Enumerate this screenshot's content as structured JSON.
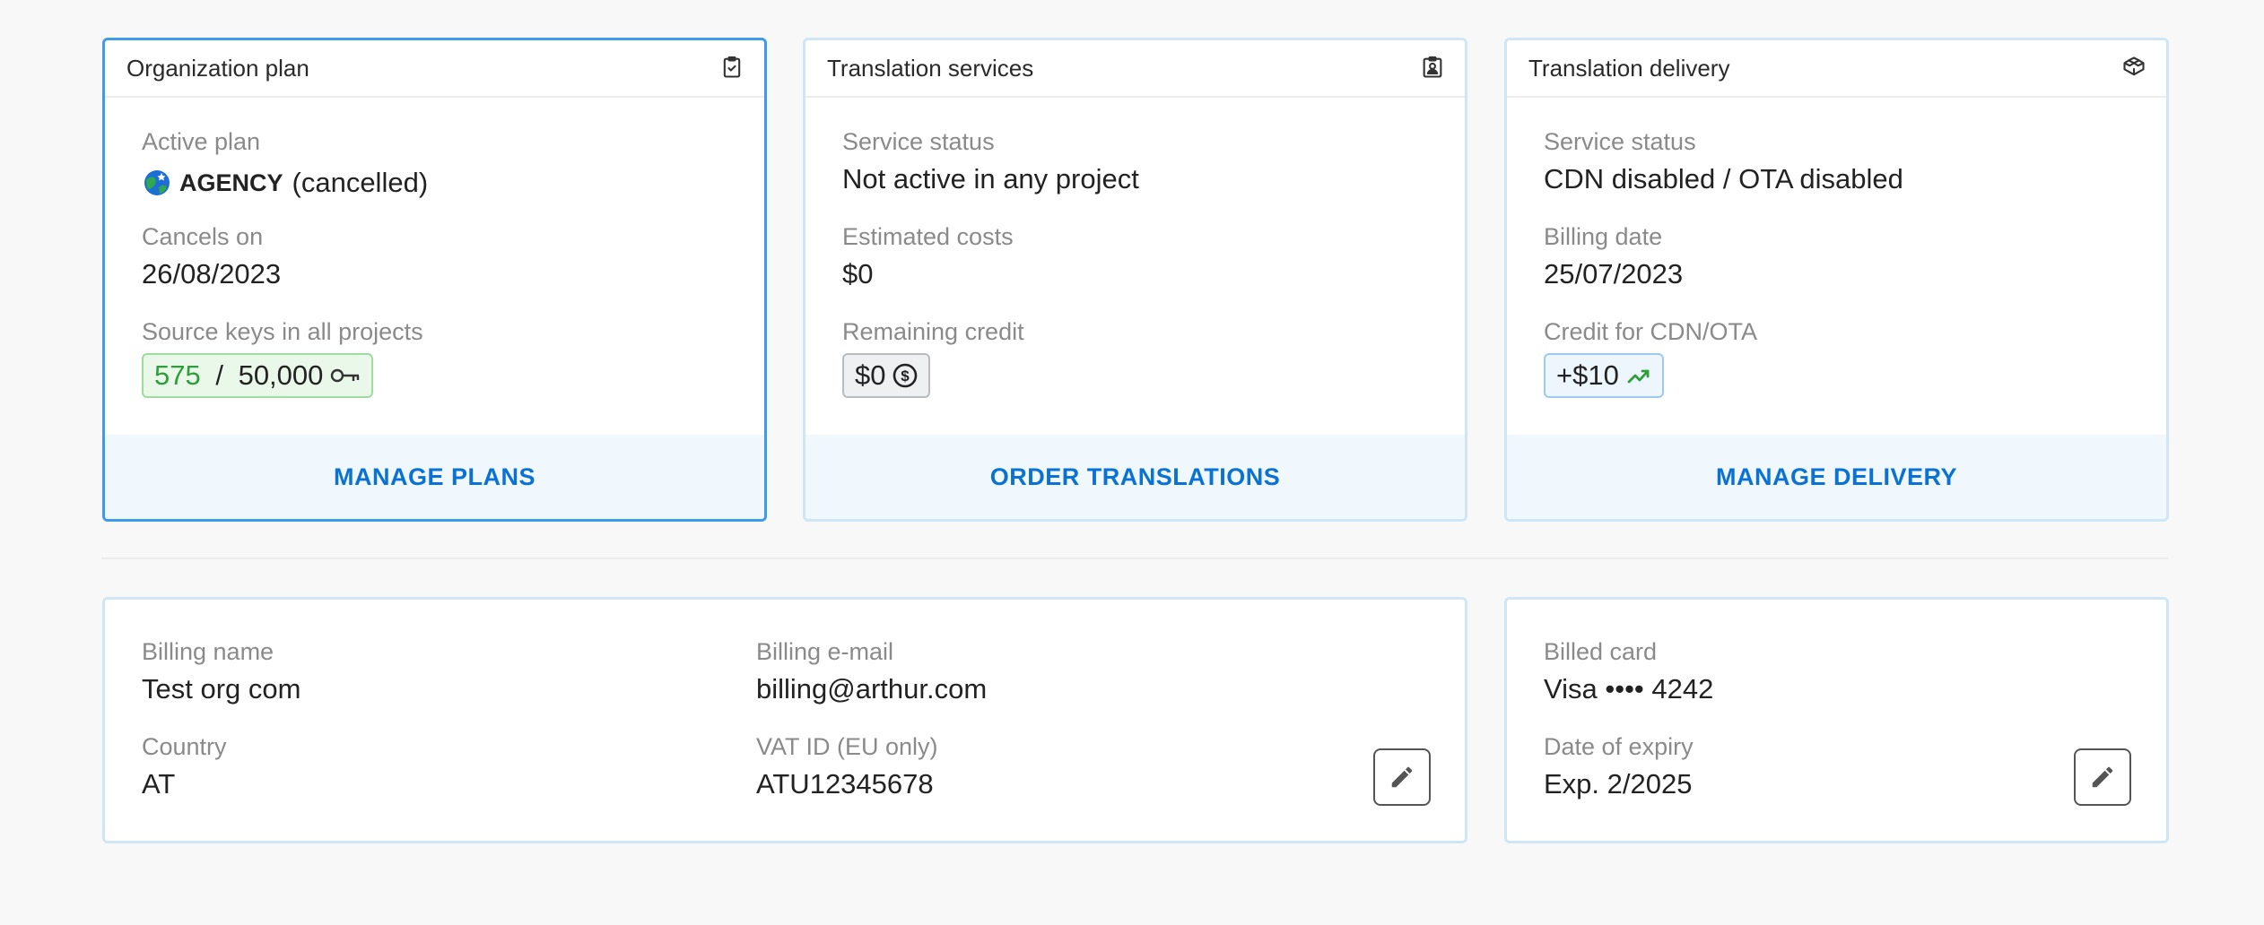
{
  "org_plan": {
    "title": "Organization plan",
    "icon": "clipboard-check-icon",
    "active_plan_label": "Active plan",
    "plan_name": "AGENCY",
    "plan_status": "(cancelled)",
    "cancels_on_label": "Cancels on",
    "cancels_on_value": "26/08/2023",
    "source_keys_label": "Source keys in all projects",
    "keys_used": "575",
    "keys_separator": " / ",
    "keys_limit": "50,000",
    "footer_link": "MANAGE PLANS"
  },
  "translation_services": {
    "title": "Translation services",
    "icon": "badge-icon",
    "status_label": "Service status",
    "status_value": "Not active in any project",
    "costs_label": "Estimated costs",
    "costs_value": "$0",
    "credit_label": "Remaining credit",
    "credit_value": "$0",
    "footer_link": "ORDER TRANSLATIONS"
  },
  "translation_delivery": {
    "title": "Translation delivery",
    "icon": "boxes-icon",
    "status_label": "Service status",
    "status_value": "CDN disabled / OTA disabled",
    "billing_date_label": "Billing date",
    "billing_date_value": "25/07/2023",
    "credit_label": "Credit for CDN/OTA",
    "credit_value": "+$10",
    "footer_link": "MANAGE DELIVERY"
  },
  "billing_info": {
    "name_label": "Billing name",
    "name_value": "Test org com",
    "email_label": "Billing e-mail",
    "email_value": "billing@arthur.com",
    "country_label": "Country",
    "country_value": "AT",
    "vat_label": "VAT ID (EU only)",
    "vat_value": "ATU12345678"
  },
  "billed_card": {
    "card_label": "Billed card",
    "card_value": "Visa •••• 4242",
    "expiry_label": "Date of expiry",
    "expiry_value": "Exp. 2/2025"
  },
  "colors": {
    "accent": "#0a72d4",
    "selected_border": "#3d9be9",
    "card_border": "#cfe6f6",
    "success": "#2e9e3a"
  }
}
